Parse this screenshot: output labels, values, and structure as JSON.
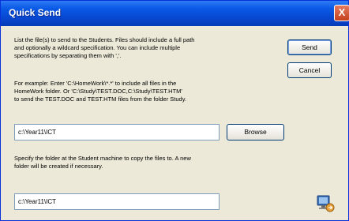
{
  "window": {
    "title": "Quick Send",
    "close_glyph": "X"
  },
  "instructions": {
    "line1": "List the file(s) to send to the Students. Files should include a full path",
    "line2": "and optionally a wildcard specification. You can include multiple",
    "line3": "specifications by separating them with ','."
  },
  "example": {
    "line1": "For example: Enter 'C:\\HomeWork\\*.*' to include all files in the",
    "line2": "HomeWork folder. Or 'C:\\Study\\TEST.DOC,C:\\Study\\TEST.HTM'",
    "line3": "to send the TEST.DOC and TEST.HTM files from the folder Study."
  },
  "files_field": {
    "value": "c:\\Year11\\ICT"
  },
  "buttons": {
    "send": "Send",
    "cancel": "Cancel",
    "browse": "Browse"
  },
  "destination": {
    "line1": "Specify the folder at the Student machine to copy the files to. A new",
    "line2": "folder will be created if necessary."
  },
  "dest_field": {
    "value": "c:\\Year11\\ICT"
  },
  "icons": {
    "close": "close-icon",
    "app": "computer-send-icon"
  }
}
